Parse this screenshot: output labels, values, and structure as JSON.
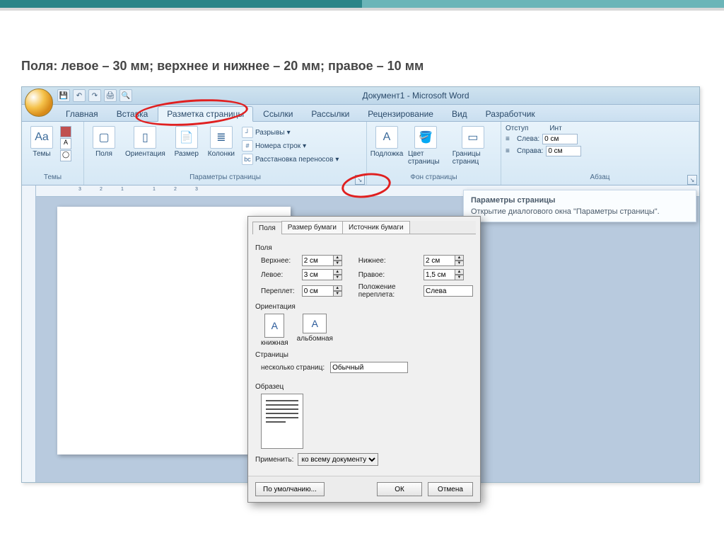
{
  "slide": {
    "heading": "Поля: левое – 30 мм; верхнее и нижнее – 20 мм; правое – 10 мм"
  },
  "window": {
    "title": "Документ1 - Microsoft Word"
  },
  "qat": {
    "save": "💾",
    "undo": "↶",
    "redo": "↷",
    "print": "🖨",
    "preview": "🔍"
  },
  "tabs": {
    "home": "Главная",
    "insert": "Вставка",
    "layout": "Разметка страницы",
    "references": "Ссылки",
    "mailings": "Рассылки",
    "review": "Рецензирование",
    "view": "Вид",
    "developer": "Разработчик"
  },
  "ribbon": {
    "themes_group": "Темы",
    "themes": "Темы",
    "page_setup_group": "Параметры страницы",
    "margins": "Поля",
    "orientation": "Ориентация",
    "size": "Размер",
    "columns": "Колонки",
    "breaks": "Разрывы",
    "line_numbers": "Номера строк",
    "hyphenation": "Расстановка переносов",
    "page_bg_group": "Фон страницы",
    "watermark": "Подложка",
    "page_color": "Цвет страницы",
    "page_borders": "Границы страниц",
    "paragraph_group": "Абзац",
    "indent_label": "Отступ",
    "left_label": "Слева:",
    "right_label": "Справа:",
    "indent_left_val": "0 см",
    "indent_right_val": "0 см",
    "spacing_label": "Инт"
  },
  "tooltip": {
    "title": "Параметры страницы",
    "text": "Открытие диалогового окна \"Параметры страницы\"."
  },
  "dialog": {
    "tab_fields": "Поля",
    "tab_paper": "Размер бумаги",
    "tab_source": "Источник бумаги",
    "section_fields": "Поля",
    "top_label": "Верхнее:",
    "top_val": "2 см",
    "bottom_label": "Нижнее:",
    "bottom_val": "2 см",
    "left_label": "Левое:",
    "left_val": "3 см",
    "right_label": "Правое:",
    "right_val": "1,5 см",
    "gutter_label": "Переплет:",
    "gutter_val": "0 см",
    "gutter_pos_label": "Положение переплета:",
    "gutter_pos_val": "Слева",
    "section_orientation": "Ориентация",
    "portrait": "книжная",
    "landscape": "альбомная",
    "section_pages": "Страницы",
    "multi_pages_label": "несколько страниц:",
    "multi_pages_val": "Обычный",
    "section_preview": "Образец",
    "apply_label": "Применить:",
    "apply_val": "ко всему документу",
    "defaults_btn": "По умолчанию...",
    "ok_btn": "ОК",
    "cancel_btn": "Отмена"
  }
}
